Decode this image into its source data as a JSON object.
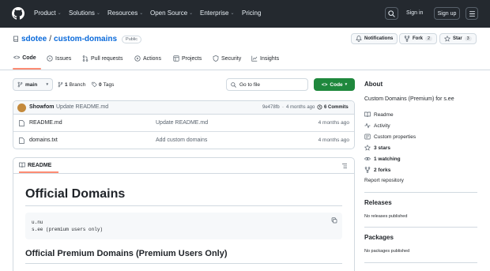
{
  "header": {
    "nav": [
      "Product",
      "Solutions",
      "Resources",
      "Open Source",
      "Enterprise",
      "Pricing"
    ],
    "sign_in": "Sign in",
    "sign_up": "Sign up"
  },
  "repo": {
    "owner": "sdotee",
    "separator": "/",
    "name": "custom-domains",
    "visibility": "Public",
    "notifications_label": "Notifications",
    "fork_label": "Fork",
    "fork_count": "2",
    "star_label": "Star",
    "star_count": "3"
  },
  "tabs": [
    "Code",
    "Issues",
    "Pull requests",
    "Actions",
    "Projects",
    "Security",
    "Insights"
  ],
  "filenav": {
    "branch": "main",
    "branch_count": "1",
    "branch_label": "Branch",
    "tags_count": "0",
    "tags_label": "Tags",
    "search_placeholder": "Go to file",
    "code_button": "Code"
  },
  "commit": {
    "author": "Showfom",
    "message": "Update README.md",
    "hash": "9e478fb",
    "separator": "·",
    "time": "4 months ago",
    "commits_label": "6 Commits"
  },
  "files": [
    {
      "name": "README.md",
      "message": "Update README.md",
      "time": "4 months ago"
    },
    {
      "name": "domains.txt",
      "message": "Add custom domains",
      "time": "4 months ago"
    }
  ],
  "readme": {
    "tab_label": "README",
    "h1": "Official Domains",
    "code_line1": "u.nu",
    "code_line2": "s.ee (premium users only)",
    "h2": "Official Premium Domains (Premium Users Only)"
  },
  "sidebar": {
    "about_heading": "About",
    "description": "Custom Domains (Premium) for s.ee",
    "items": [
      "Readme",
      "Activity",
      "Custom properties",
      "3 stars",
      "1 watching",
      "2 forks"
    ],
    "report": "Report repository",
    "releases_heading": "Releases",
    "releases_text": "No releases published",
    "packages_heading": "Packages",
    "packages_text": "No packages published"
  },
  "colors": {
    "header_bg": "#24292f",
    "link": "#0969da",
    "green": "#1f883d",
    "tab_accent": "#fd8c73"
  }
}
